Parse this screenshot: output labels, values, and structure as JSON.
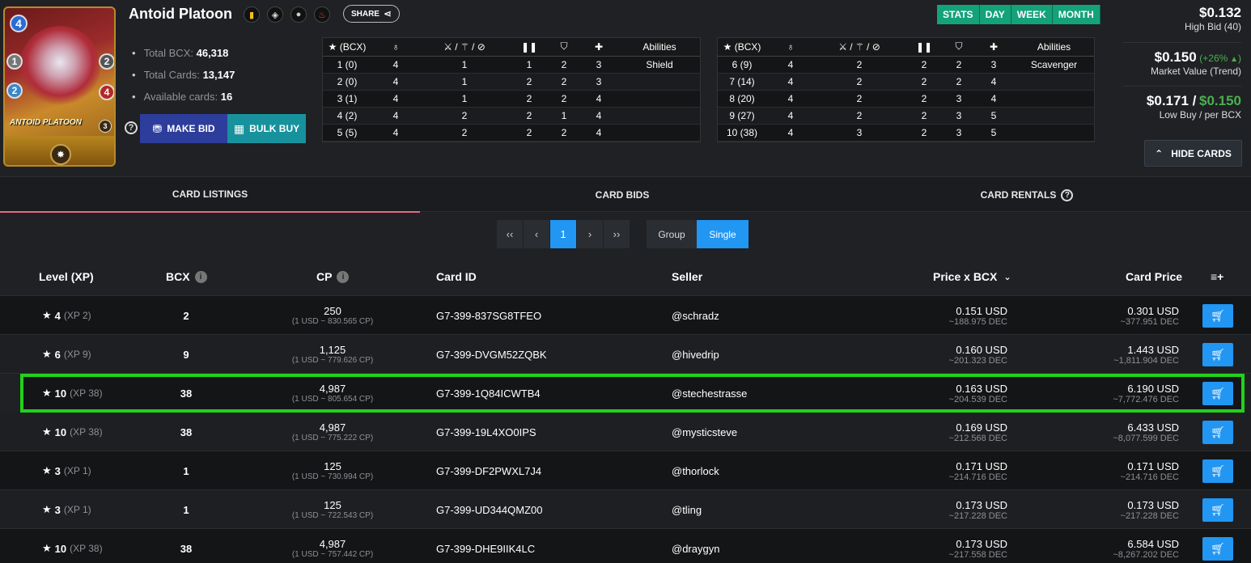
{
  "card": {
    "name": "Antoid Platoon",
    "art_label": "ANTOID PLATOON",
    "mana": "4",
    "melee": "1",
    "speed": "2",
    "armor": "2",
    "health": "4",
    "level_badge": "3"
  },
  "share_label": "SHARE",
  "stats": {
    "total_bcx_label": "Total BCX:",
    "total_bcx": "46,318",
    "total_cards_label": "Total Cards:",
    "total_cards": "13,147",
    "available_label": "Available cards:",
    "available": "16"
  },
  "actions": {
    "make_bid": "MAKE BID",
    "bulk_buy": "BULK BUY",
    "help": "?"
  },
  "level_table_headers": {
    "bcx": "(BCX)",
    "abilities": "Abilities"
  },
  "level_table_left": [
    {
      "lvl": "1 (0)",
      "a": "4",
      "b": "1",
      "c": "1",
      "d": "2",
      "e": "3",
      "ab": "Shield"
    },
    {
      "lvl": "2 (0)",
      "a": "4",
      "b": "1",
      "c": "2",
      "d": "2",
      "e": "3",
      "ab": ""
    },
    {
      "lvl": "3 (1)",
      "a": "4",
      "b": "1",
      "c": "2",
      "d": "2",
      "e": "4",
      "ab": ""
    },
    {
      "lvl": "4 (2)",
      "a": "4",
      "b": "2",
      "c": "2",
      "d": "1",
      "e": "4",
      "ab": ""
    },
    {
      "lvl": "5 (5)",
      "a": "4",
      "b": "2",
      "c": "2",
      "d": "2",
      "e": "4",
      "ab": ""
    }
  ],
  "level_table_right": [
    {
      "lvl": "6 (9)",
      "a": "4",
      "b": "2",
      "c": "2",
      "d": "2",
      "e": "3",
      "ab": "Scavenger"
    },
    {
      "lvl": "7 (14)",
      "a": "4",
      "b": "2",
      "c": "2",
      "d": "2",
      "e": "4",
      "ab": ""
    },
    {
      "lvl": "8 (20)",
      "a": "4",
      "b": "2",
      "c": "2",
      "d": "3",
      "e": "4",
      "ab": ""
    },
    {
      "lvl": "9 (27)",
      "a": "4",
      "b": "2",
      "c": "2",
      "d": "3",
      "e": "5",
      "ab": ""
    },
    {
      "lvl": "10 (38)",
      "a": "4",
      "b": "3",
      "c": "2",
      "d": "3",
      "e": "5",
      "ab": ""
    }
  ],
  "period_tabs": [
    "STATS",
    "DAY",
    "WEEK",
    "MONTH"
  ],
  "prices": {
    "high_bid": "$0.132",
    "high_bid_label": "High Bid (40)",
    "market_value": "$0.150",
    "market_trend": "(+26%",
    "market_label": "Market Value (Trend)",
    "low_buy": "$0.171 /",
    "per_bcx": "$0.150",
    "low_label": "Low Buy / per BCX",
    "hide_cards": "HIDE CARDS"
  },
  "tabs": {
    "listings": "CARD LISTINGS",
    "bids": "CARD BIDS",
    "rentals": "CARD RENTALS"
  },
  "pager": {
    "first": "‹‹",
    "prev": "‹",
    "page": "1",
    "next": "›",
    "last": "››"
  },
  "mode": {
    "group": "Group",
    "single": "Single"
  },
  "columns": {
    "level": "Level (XP)",
    "bcx": "BCX",
    "cp": "CP",
    "card_id": "Card ID",
    "seller": "Seller",
    "price_bcx": "Price x BCX",
    "card_price": "Card Price"
  },
  "listings": [
    {
      "level": "4",
      "xp": "(XP 2)",
      "bcx": "2",
      "cp": "250",
      "cp_sub": "(1 USD ~ 830.565 CP)",
      "id": "G7-399-837SG8TFEO",
      "seller": "@schradz",
      "pbcx": "0.151 USD",
      "pbcx_dec": "~188.975 DEC",
      "price": "0.301 USD",
      "price_dec": "~377.951 DEC"
    },
    {
      "level": "6",
      "xp": "(XP 9)",
      "bcx": "9",
      "cp": "1,125",
      "cp_sub": "(1 USD ~ 779.626 CP)",
      "id": "G7-399-DVGM52ZQBK",
      "seller": "@hivedrip",
      "pbcx": "0.160 USD",
      "pbcx_dec": "~201.323 DEC",
      "price": "1.443 USD",
      "price_dec": "~1,811.904 DEC"
    },
    {
      "level": "10",
      "xp": "(XP 38)",
      "bcx": "38",
      "cp": "4,987",
      "cp_sub": "(1 USD ~ 805.654 CP)",
      "id": "G7-399-1Q84ICWTB4",
      "seller": "@stechestrasse",
      "pbcx": "0.163 USD",
      "pbcx_dec": "~204.539 DEC",
      "price": "6.190 USD",
      "price_dec": "~7,772.476 DEC"
    },
    {
      "level": "10",
      "xp": "(XP 38)",
      "bcx": "38",
      "cp": "4,987",
      "cp_sub": "(1 USD ~ 775.222 CP)",
      "id": "G7-399-19L4XO0IPS",
      "seller": "@mysticsteve",
      "pbcx": "0.169 USD",
      "pbcx_dec": "~212.568 DEC",
      "price": "6.433 USD",
      "price_dec": "~8,077.599 DEC"
    },
    {
      "level": "3",
      "xp": "(XP 1)",
      "bcx": "1",
      "cp": "125",
      "cp_sub": "(1 USD ~ 730.994 CP)",
      "id": "G7-399-DF2PWXL7J4",
      "seller": "@thorlock",
      "pbcx": "0.171 USD",
      "pbcx_dec": "~214.716 DEC",
      "price": "0.171 USD",
      "price_dec": "~214.716 DEC"
    },
    {
      "level": "3",
      "xp": "(XP 1)",
      "bcx": "1",
      "cp": "125",
      "cp_sub": "(1 USD ~ 722.543 CP)",
      "id": "G7-399-UD344QMZ00",
      "seller": "@tling",
      "pbcx": "0.173 USD",
      "pbcx_dec": "~217.228 DEC",
      "price": "0.173 USD",
      "price_dec": "~217.228 DEC"
    },
    {
      "level": "10",
      "xp": "(XP 38)",
      "bcx": "38",
      "cp": "4,987",
      "cp_sub": "(1 USD ~ 757.442 CP)",
      "id": "G7-399-DHE9IIK4LC",
      "seller": "@draygyn",
      "pbcx": "0.173 USD",
      "pbcx_dec": "~217.558 DEC",
      "price": "6.584 USD",
      "price_dec": "~8,267.202 DEC"
    }
  ],
  "colors": {
    "accent": "#2196f3",
    "stats_green": "#14a27a",
    "highlight": "#22d21b",
    "tab_underline": "#e56b82"
  }
}
